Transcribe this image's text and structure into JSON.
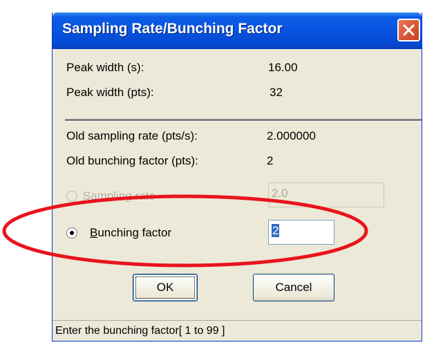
{
  "dialog": {
    "title": "Sampling Rate/Bunching Factor",
    "close_icon": "close-icon"
  },
  "info": {
    "peak_width_s_label": "Peak width (s):",
    "peak_width_s_value": "16.00",
    "peak_width_pts_label": "Peak width (pts):",
    "peak_width_pts_value": "32",
    "old_sampling_rate_label": "Old sampling rate (pts/s):",
    "old_sampling_rate_value": "2.000000",
    "old_bunching_factor_label": "Old bunching factor (pts):",
    "old_bunching_factor_value": "2"
  },
  "options": {
    "sampling_rate": {
      "mnemonic": "S",
      "label_rest": "ampling rate",
      "value": "2.0",
      "enabled": false,
      "selected": false
    },
    "bunching_factor": {
      "mnemonic": "B",
      "label_rest": "unching factor",
      "value": "2",
      "enabled": true,
      "selected": true
    }
  },
  "buttons": {
    "ok_label": "OK",
    "cancel_label": "Cancel"
  },
  "status": {
    "text": "Enter the bunching factor[ 1 to 99 ]"
  },
  "colors": {
    "titlebar": "#0653e0",
    "dialog_bg": "#ece9d8",
    "highlight_ellipse": "#e8141c",
    "selection": "#316ac5"
  }
}
